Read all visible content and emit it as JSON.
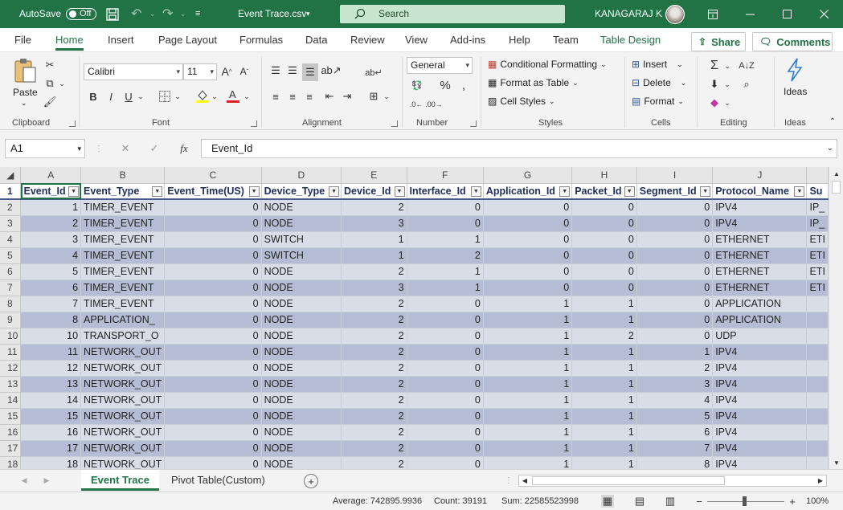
{
  "titlebar": {
    "autosave_label": "AutoSave",
    "autosave_state": "Off",
    "file_name": "Event Trace.csv",
    "search_placeholder": "Search",
    "user_name": "KANAGARAJ K"
  },
  "tabs": [
    "File",
    "Home",
    "Insert",
    "Page Layout",
    "Formulas",
    "Data",
    "Review",
    "View",
    "Add-ins",
    "Help",
    "Team",
    "Table Design"
  ],
  "active_tab": "Home",
  "share_label": "Share",
  "comments_label": "Comments",
  "ribbon": {
    "clipboard": {
      "label": "Clipboard",
      "paste": "Paste"
    },
    "font": {
      "label": "Font",
      "font_name": "Calibri",
      "font_size": "11"
    },
    "alignment": {
      "label": "Alignment"
    },
    "number": {
      "label": "Number",
      "format": "General"
    },
    "styles": {
      "label": "Styles",
      "conditional": "Conditional Formatting",
      "format_table": "Format as Table",
      "cell_styles": "Cell Styles"
    },
    "cells": {
      "label": "Cells",
      "insert": "Insert",
      "delete": "Delete",
      "format": "Format"
    },
    "editing": {
      "label": "Editing"
    },
    "ideas": {
      "label": "Ideas",
      "button": "Ideas"
    }
  },
  "formula_bar": {
    "name_box": "A1",
    "content": "Event_Id"
  },
  "grid": {
    "columns": [
      "A",
      "B",
      "C",
      "D",
      "E",
      "F",
      "G",
      "H",
      "I",
      "J",
      ""
    ],
    "headers": [
      "Event_Id",
      "Event_Type",
      "Event_Time(US)",
      "Device_Type",
      "Device_Id",
      "Interface_Id",
      "Application_Id",
      "Packet_Id",
      "Segment_Id",
      "Protocol_Name",
      "Su"
    ],
    "rows": [
      [
        "1",
        "TIMER_EVENT",
        "0",
        "NODE",
        "2",
        "0",
        "0",
        "0",
        "0",
        "IPV4",
        "IP_"
      ],
      [
        "2",
        "TIMER_EVENT",
        "0",
        "NODE",
        "3",
        "0",
        "0",
        "0",
        "0",
        "IPV4",
        "IP_"
      ],
      [
        "3",
        "TIMER_EVENT",
        "0",
        "SWITCH",
        "1",
        "1",
        "0",
        "0",
        "0",
        "ETHERNET",
        "ETI"
      ],
      [
        "4",
        "TIMER_EVENT",
        "0",
        "SWITCH",
        "1",
        "2",
        "0",
        "0",
        "0",
        "ETHERNET",
        "ETI"
      ],
      [
        "5",
        "TIMER_EVENT",
        "0",
        "NODE",
        "2",
        "1",
        "0",
        "0",
        "0",
        "ETHERNET",
        "ETI"
      ],
      [
        "6",
        "TIMER_EVENT",
        "0",
        "NODE",
        "3",
        "1",
        "0",
        "0",
        "0",
        "ETHERNET",
        "ETI"
      ],
      [
        "7",
        "TIMER_EVENT",
        "0",
        "NODE",
        "2",
        "0",
        "1",
        "1",
        "0",
        "APPLICATION",
        ""
      ],
      [
        "8",
        "APPLICATION_",
        "0",
        "NODE",
        "2",
        "0",
        "1",
        "1",
        "0",
        "APPLICATION",
        ""
      ],
      [
        "10",
        "TRANSPORT_O",
        "0",
        "NODE",
        "2",
        "0",
        "1",
        "2",
        "0",
        "UDP",
        ""
      ],
      [
        "11",
        "NETWORK_OUT",
        "0",
        "NODE",
        "2",
        "0",
        "1",
        "1",
        "1",
        "IPV4",
        ""
      ],
      [
        "12",
        "NETWORK_OUT",
        "0",
        "NODE",
        "2",
        "0",
        "1",
        "1",
        "2",
        "IPV4",
        ""
      ],
      [
        "13",
        "NETWORK_OUT",
        "0",
        "NODE",
        "2",
        "0",
        "1",
        "1",
        "3",
        "IPV4",
        ""
      ],
      [
        "14",
        "NETWORK_OUT",
        "0",
        "NODE",
        "2",
        "0",
        "1",
        "1",
        "4",
        "IPV4",
        ""
      ],
      [
        "15",
        "NETWORK_OUT",
        "0",
        "NODE",
        "2",
        "0",
        "1",
        "1",
        "5",
        "IPV4",
        ""
      ],
      [
        "16",
        "NETWORK_OUT",
        "0",
        "NODE",
        "2",
        "0",
        "1",
        "1",
        "6",
        "IPV4",
        ""
      ],
      [
        "17",
        "NETWORK_OUT",
        "0",
        "NODE",
        "2",
        "0",
        "1",
        "1",
        "7",
        "IPV4",
        ""
      ],
      [
        "18",
        "NETWORK_OUT",
        "0",
        "NODE",
        "2",
        "0",
        "1",
        "1",
        "8",
        "IPV4",
        ""
      ]
    ],
    "row_numbers": [
      "1",
      "2",
      "3",
      "4",
      "5",
      "6",
      "7",
      "8",
      "9",
      "10",
      "11",
      "12",
      "13",
      "14",
      "15",
      "16",
      "17",
      "18"
    ]
  },
  "sheets": [
    "Event Trace",
    "Pivot Table(Custom)"
  ],
  "status": {
    "average": "Average: 742895.9936",
    "count": "Count: 39191",
    "sum": "Sum: 22585523998",
    "zoom": "100%"
  },
  "colors": {
    "brand": "#217346",
    "band_dark": "#b4bdd4",
    "band_light": "#d9dde8"
  }
}
